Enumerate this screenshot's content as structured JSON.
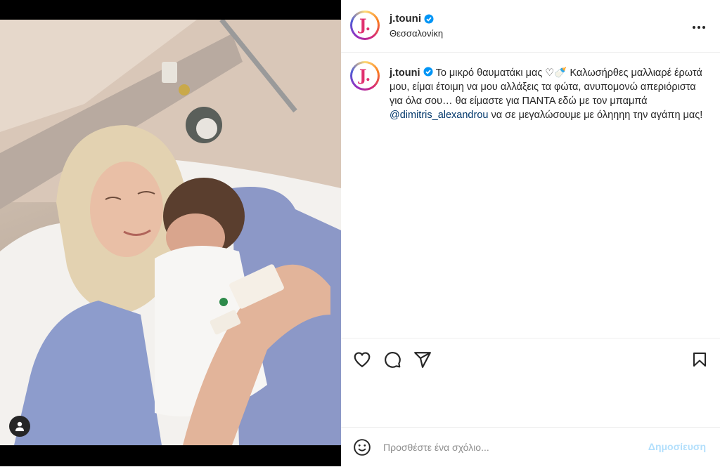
{
  "post": {
    "photo_alt": "",
    "author": {
      "username": "j.touni",
      "avatar_letter": "J.",
      "verified": true,
      "location": "Θεσσαλονίκη"
    },
    "caption": {
      "username": "j.touni",
      "text_before_mention": "Το μικρό θαυματάκι μας ♡🍼 Καλωσήρθες μαλλιαρέ έρωτά μου, είμαι έτοιμη να μου αλλάξεις τα φώτα, ανυπομονώ απεριόριστα για όλα σου… θα είμαστε για ΠΑΝΤΑ εδώ με τον μπαμπά ",
      "mention": "@dimitris_alexandrou",
      "text_after_mention": " να σε μεγαλώσουμε με όληηηη την αγάπη μας!"
    },
    "actions": {
      "like_icon": "heart-icon",
      "comment_icon": "comment-icon",
      "share_icon": "share-icon",
      "save_icon": "bookmark-icon"
    },
    "comment_box": {
      "placeholder": "Προσθέστε ένα σχόλιο...",
      "post_label": "Δημοσίευση",
      "emoji_icon": "emoji-icon"
    },
    "more_icon": "more-options-icon",
    "user_tag_icon": "user-tag-icon"
  },
  "colors": {
    "verified_blue": "#0095f6",
    "post_button_disabled": "#b2dffc",
    "mention": "#00376b",
    "avatar_letter": "#e0316f"
  }
}
